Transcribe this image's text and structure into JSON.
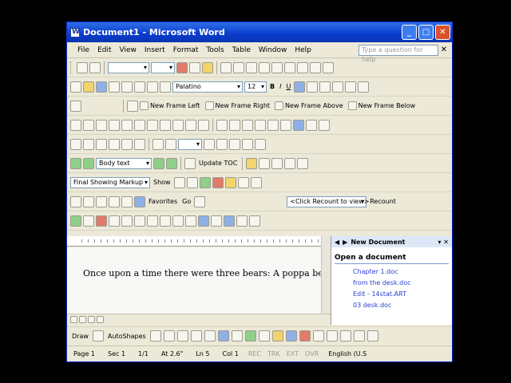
{
  "window": {
    "title": "Document1 - Microsoft Word"
  },
  "menu": {
    "items": [
      "File",
      "Edit",
      "View",
      "Insert",
      "Format",
      "Tools",
      "Table",
      "Window",
      "Help"
    ],
    "help_placeholder": "Type a question for help"
  },
  "formatting": {
    "font": "Palatino",
    "size": "12",
    "bold": "B",
    "italic": "I",
    "underline": "U"
  },
  "frames": {
    "new_frame_left": "New Frame Left",
    "new_frame_right": "New Frame Right",
    "new_frame_above": "New Frame Above",
    "new_frame_below": "New Frame Below"
  },
  "outlining": {
    "style": "Body text",
    "update_toc": "Update TOC"
  },
  "reviewing": {
    "display": "Final Showing Markup",
    "show": "Show"
  },
  "web": {
    "favorites": "Favorites",
    "go": "Go",
    "recount_placeholder": "<Click Recount to view>",
    "recount": "Recount"
  },
  "document": {
    "text": "Once upon a time there were three bears: A poppa bear"
  },
  "taskpane": {
    "title": "New Document",
    "section": "Open a document",
    "files": [
      "Chapter 1.doc",
      "from the desk.doc",
      "Edit - 14stat.ART",
      "03 desk.doc"
    ]
  },
  "drawing": {
    "draw": "Draw",
    "autoshapes": "AutoShapes"
  },
  "status": {
    "page": "Page 1",
    "sec": "Sec 1",
    "pages": "1/1",
    "at": "At 2.6\"",
    "ln": "Ln 5",
    "col": "Col 1",
    "rec": "REC",
    "trk": "TRK",
    "ext": "EXT",
    "ovr": "OVR",
    "lang": "English (U.S"
  }
}
